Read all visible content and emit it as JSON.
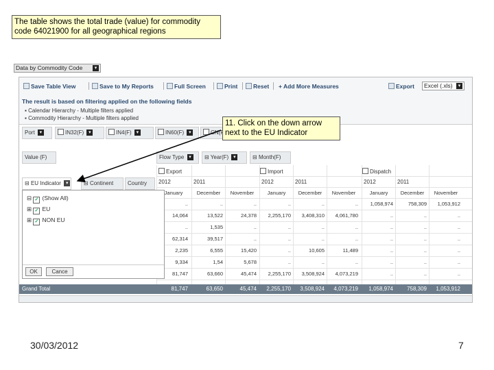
{
  "callout_top": "The table shows the total trade (value) for commodity code 64021900 for all geographical regions",
  "callout_step": "11. Click on the down arrow next to the EU Indicator",
  "report_selector": "Data by Commodity Code",
  "toolbar": {
    "save_table_view": "Save Table View",
    "save_to_reports": "Save to My Reports",
    "full_screen": "Full Screen",
    "print": "Print",
    "reset": "Reset",
    "add_measures": "+ Add More Measures",
    "export": "Export",
    "export_format": "Excel (.xls)"
  },
  "filters": {
    "heading": "The result is based on filtering applied on the following fields",
    "line1": "Calendar Hierarchy - Multiple filters applied",
    "line2": "Commodity Hierarchy - Multiple filters applied"
  },
  "controls": {
    "port": "Port",
    "c1": "IN32(F)",
    "c2": "IN4(F)",
    "c3": "IN60(F)",
    "c4": "CN(F)",
    "value": "Value (F)",
    "flow_type": "Flow Type",
    "year": "Year(F)",
    "month": "Month(F)",
    "eu_indicator": "EU Indicator",
    "continent": "Continent",
    "country": "Country"
  },
  "flows": [
    "Export",
    "Import",
    "Dispatch"
  ],
  "years": [
    "2012",
    "2011",
    "2012",
    "2011",
    "2012",
    "2011"
  ],
  "months": [
    "January",
    "December",
    "November",
    "January",
    "December",
    "November",
    "January",
    "December",
    "November"
  ],
  "rows": [
    [
      "..",
      "..",
      "..",
      "..",
      "..",
      "..",
      "1,058,974",
      "758,309",
      "1,053,912"
    ],
    [
      "14,064",
      "13,522",
      "24,378",
      "2,255,170",
      "3,408,310",
      "4,061,780",
      "..",
      "..",
      ".."
    ],
    [
      "..",
      "1,535",
      "..",
      "..",
      "..",
      "..",
      "..",
      "..",
      ".."
    ],
    [
      "62,314",
      "39,517",
      "..",
      "..",
      "..",
      "..",
      "..",
      "..",
      ".."
    ],
    [
      "2,235",
      "6,555",
      "15,420",
      "..",
      "10,605",
      "11,489",
      "..",
      "..",
      ".."
    ],
    [
      "9,334",
      "1,54",
      "5,678",
      "..",
      "..",
      "..",
      "..",
      "..",
      ".."
    ],
    [
      "81,747",
      "63,660",
      "45,474",
      "2,255,170",
      "3,508,924",
      "4,073,219",
      "..",
      "..",
      ".."
    ]
  ],
  "filter_panel": {
    "show_all": "(Show All)",
    "eu": "EU",
    "non_eu": "NON EU",
    "ok": "OK",
    "cancel": "Cance"
  },
  "grand_total": {
    "label": "Grand Total",
    "values": [
      "81,747",
      "63,650",
      "45,474",
      "2,255,170",
      "3,508,924",
      "4,073,219",
      "1,058,974",
      "758,309",
      "1,053,912"
    ]
  },
  "footer_date": "30/03/2012",
  "page_number": "7"
}
